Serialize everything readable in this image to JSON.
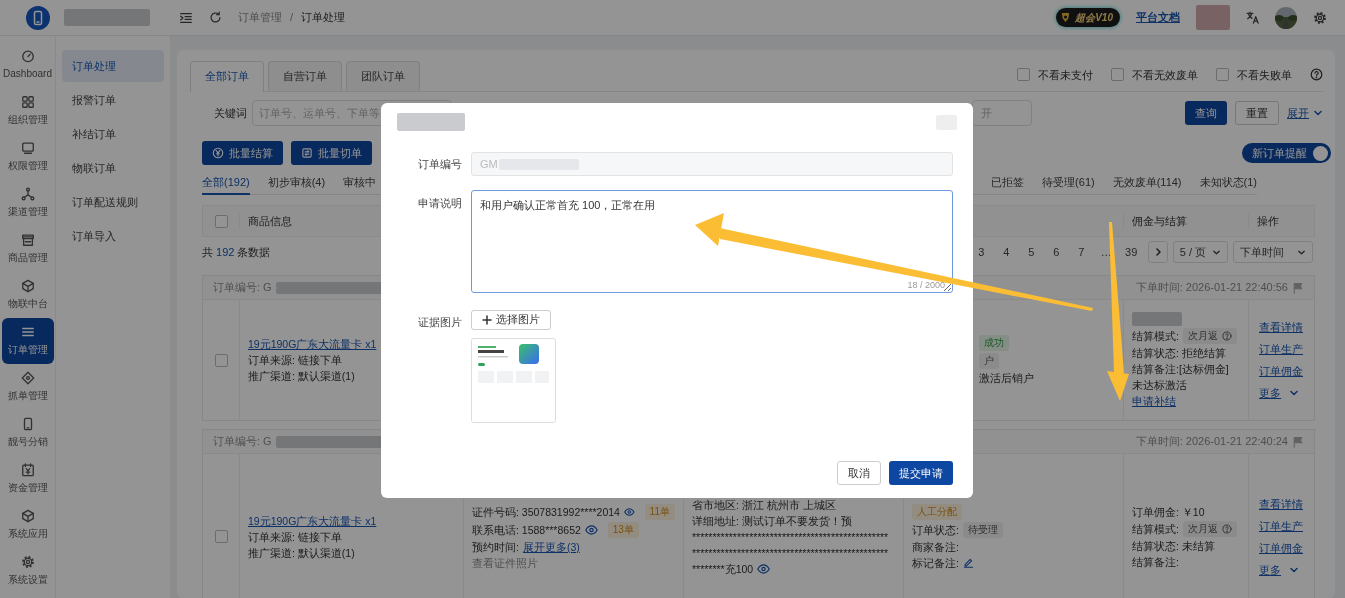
{
  "header": {
    "breadcrumb": {
      "items": [
        "订单管理",
        "订单处理"
      ],
      "separator": "/"
    },
    "vip_badge": "超会V10",
    "docs_link": "平台文档"
  },
  "rail": [
    {
      "label": "Dashboard",
      "selected": false
    },
    {
      "label": "组织管理",
      "selected": false
    },
    {
      "label": "权限管理",
      "selected": false
    },
    {
      "label": "渠道管理",
      "selected": false
    },
    {
      "label": "商品管理",
      "selected": false
    },
    {
      "label": "物联中台",
      "selected": false
    },
    {
      "label": "订单管理",
      "selected": true
    },
    {
      "label": "抓单管理",
      "selected": false
    },
    {
      "label": "靓号分销",
      "selected": false
    },
    {
      "label": "资金管理",
      "selected": false
    },
    {
      "label": "系统应用",
      "selected": false
    },
    {
      "label": "系统设置",
      "selected": false
    }
  ],
  "submenu": [
    {
      "label": "订单处理",
      "selected": true
    },
    {
      "label": "报警订单",
      "selected": false
    },
    {
      "label": "补结订单",
      "selected": false
    },
    {
      "label": "物联订单",
      "selected": false
    },
    {
      "label": "订单配送规则",
      "selected": false
    },
    {
      "label": "订单导入",
      "selected": false
    }
  ],
  "order_tabs": [
    {
      "label": "全部订单",
      "selected": true
    },
    {
      "label": "自营订单",
      "selected": false
    },
    {
      "label": "团队订单",
      "selected": false
    }
  ],
  "filters": [
    {
      "label": "不看未支付",
      "checked": false
    },
    {
      "label": "不看无效废单",
      "checked": false
    },
    {
      "label": "不看失败单",
      "checked": false
    }
  ],
  "search": {
    "label": "关键词",
    "placeholder": "订单号、运单号、下单等",
    "second_placeholder": "开",
    "query_button": "查询",
    "reset_button": "重置",
    "expand_link": "展开"
  },
  "batch_buttons": [
    "批量结算",
    "批量切单"
  ],
  "new_order_alert": {
    "label": "新订单提醒",
    "on": true
  },
  "status_tabs_left": [
    {
      "label": "全部(192)",
      "selected": true
    },
    {
      "label": "初步审核(4)",
      "selected": false
    },
    {
      "label": "审核中",
      "selected": false
    }
  ],
  "status_tabs_right": [
    {
      "label": "已拒签",
      "selected": false
    },
    {
      "label": "待受理(61)",
      "selected": false
    },
    {
      "label": "无效废单(114)",
      "selected": false
    },
    {
      "label": "未知状态(1)",
      "selected": false
    }
  ],
  "table": {
    "select_all": {
      "checked": false
    },
    "goods_column": "商品信息",
    "settlement_column": "佣金与结算",
    "actions_column": "操作"
  },
  "summary": {
    "prefix": "共",
    "count": "192",
    "suffix": "条数据"
  },
  "pagination": {
    "pages": [
      {
        "label": "3",
        "selected": false
      },
      {
        "label": "4",
        "selected": false
      },
      {
        "label": "5",
        "selected": false
      },
      {
        "label": "6",
        "selected": false
      },
      {
        "label": "7",
        "selected": false
      },
      {
        "label": "…",
        "selected": false
      },
      {
        "label": "39",
        "selected": false
      }
    ],
    "page_size": "5 / 页",
    "sort": "下单时间"
  },
  "orders": [
    {
      "number": "订单编号: G",
      "time": "下单时间: 2026-01-21 22:40:56",
      "checked": false,
      "product": "19元190G广东大流量卡 x1",
      "source": "订单来源: 链接下单",
      "channel": "推广渠道: 默认渠道(1)",
      "status_lines": [
        {
          "kind": "success",
          "text": "成功"
        },
        {
          "kind": "neutral",
          "text": "户"
        },
        {
          "kind": "text",
          "text": "激活后销户"
        }
      ],
      "settlement_lines": [
        {
          "kind": "blurred"
        },
        {
          "kind": "mode",
          "label": "结算模式:",
          "tag": "次月返"
        },
        {
          "kind": "text",
          "text": "结算状态: 拒绝结算"
        },
        {
          "kind": "text",
          "text": "结算备注:[达标佣金]"
        },
        {
          "kind": "text",
          "text": "未达标激活"
        },
        {
          "kind": "link",
          "text": "申请补结"
        }
      ],
      "actions": [
        "查看详情",
        "订单生产",
        "订单佣金"
      ],
      "more": "更多"
    },
    {
      "number": "订单编号: G",
      "time": "下单时间: 2026-01-21 22:40:24",
      "checked": false,
      "product": "19元190G广东大流量卡 x1",
      "source": "订单来源: 链接下单",
      "channel": "推广渠道: 默认渠道(1)",
      "customer_lines": [
        {
          "kind": "id",
          "text": "证件号码: 3507831992****2014",
          "count": "11单"
        },
        {
          "kind": "id",
          "text": "联系电话: 1588***8652",
          "count": "13单"
        },
        {
          "kind": "expand",
          "label": "预约时间:",
          "link": "展开更多(3)"
        },
        {
          "kind": "muted",
          "text": "查看证件照片"
        }
      ],
      "address_lines": [
        {
          "kind": "text",
          "text": "省市地区: 浙江 杭州市 上城区"
        },
        {
          "kind": "text",
          "text": "详细地址: 测试订单不要发货！预"
        },
        {
          "kind": "text",
          "text": "************************************************"
        },
        {
          "kind": "text",
          "text": "************************************************"
        },
        {
          "kind": "eye",
          "text": "********充100"
        }
      ],
      "status_lines": [
        {
          "kind": "warning",
          "text": "人工分配"
        },
        {
          "kind": "tagline",
          "label": "订单状态:",
          "tag": "待受理"
        },
        {
          "kind": "text",
          "text": "商家备注:"
        },
        {
          "kind": "edit",
          "text": "标记备注:"
        }
      ],
      "settlement_lines": [
        {
          "kind": "text",
          "text": "订单佣金: ￥10"
        },
        {
          "kind": "mode",
          "label": "结算模式:",
          "tag": "次月返"
        },
        {
          "kind": "text",
          "text": "结算状态: 未结算"
        },
        {
          "kind": "text",
          "text": "结算备注:"
        }
      ],
      "actions": [
        "查看详情",
        "订单生产",
        "订单佣金"
      ],
      "more": "更多"
    }
  ],
  "dialog": {
    "order_label": "订单编号",
    "order_value": "GM",
    "note_label": "申请说明",
    "note_value": "和用户确认正常首充 100，正常在用",
    "note_counter": "18 / 2000",
    "evidence_label": "证据图片",
    "choose_button": "选择图片",
    "cancel_button": "取消",
    "submit_button": "提交申请"
  }
}
